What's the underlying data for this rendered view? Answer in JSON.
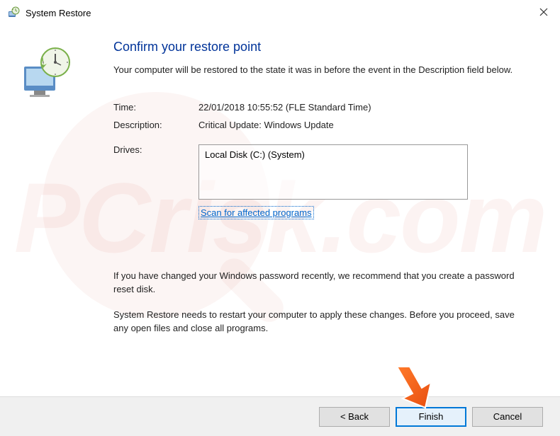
{
  "titlebar": {
    "title": "System Restore"
  },
  "main": {
    "heading": "Confirm your restore point",
    "subheading": "Your computer will be restored to the state it was in before the event in the Description field below.",
    "time_label": "Time:",
    "time_value": "22/01/2018 10:55:52 (FLE Standard Time)",
    "description_label": "Description:",
    "description_value": "Critical Update: Windows Update",
    "drives_label": "Drives:",
    "drives_value": "Local Disk (C:) (System)",
    "scan_link": "Scan for affected programs",
    "password_note": "If you have changed your Windows password recently, we recommend that you create a password reset disk.",
    "restart_note": "System Restore needs to restart your computer to apply these changes. Before you proceed, save any open files and close all programs."
  },
  "footer": {
    "back": "< Back",
    "finish": "Finish",
    "cancel": "Cancel"
  }
}
